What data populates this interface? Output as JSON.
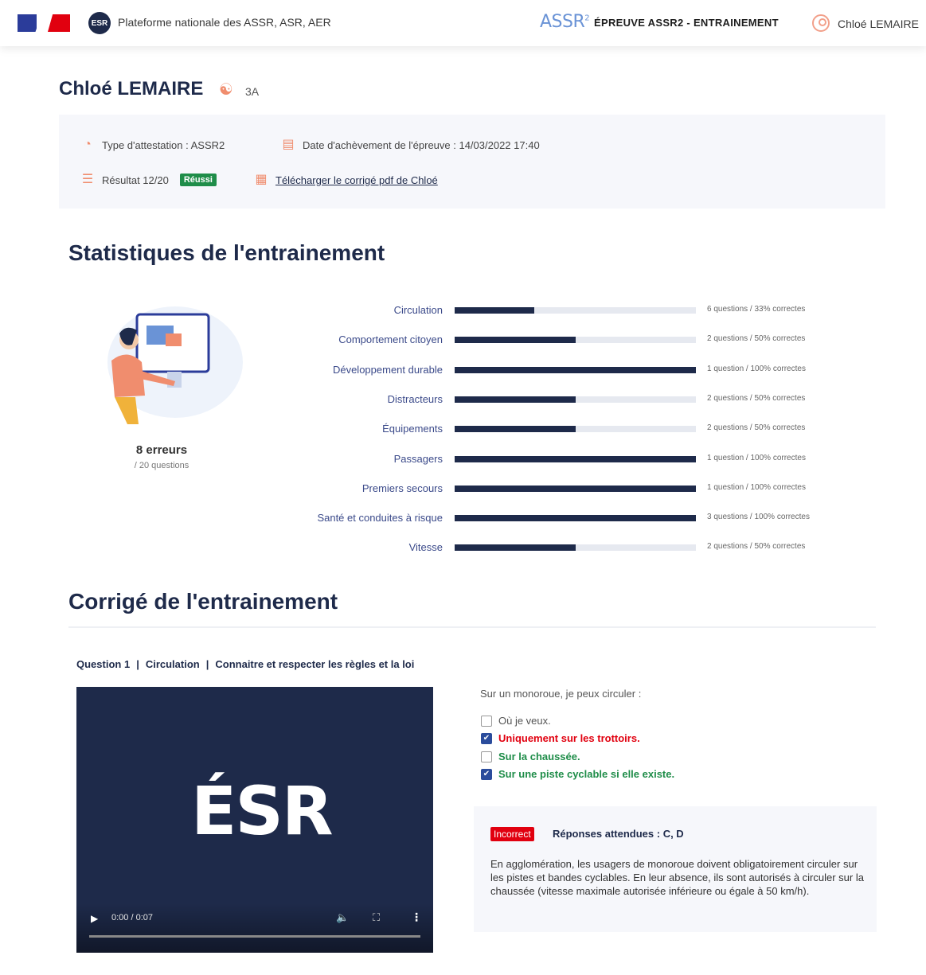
{
  "header": {
    "platform_title": "Plateforme nationale des ASSR, ASR, AER",
    "esr_badge": "ESR",
    "assr_logo": "ASSR",
    "assr_logo_sup": "2",
    "epreuve_title": "ÉPREUVE ASSR2 - ENTRAINEMENT",
    "user_name": "Chloé LEMAIRE"
  },
  "student": {
    "name": "Chloé LEMAIRE",
    "class": "3A"
  },
  "info": {
    "type_attestation": "Type d'attestation : ASSR2",
    "date_achevement": "Date d'achèvement de l'épreuve : 14/03/2022 17:40",
    "resultat": "Résultat 12/20",
    "badge": "Réussi",
    "download_link": "Télécharger le corrigé pdf de Chloé"
  },
  "stats_section": {
    "title": "Statistiques de l'entrainement",
    "errors": "8 erreurs",
    "errors_total": "/ 20 questions"
  },
  "chart_data": {
    "type": "bar",
    "orientation": "horizontal",
    "categories": [
      "Circulation",
      "Comportement citoyen",
      "Développement durable",
      "Distracteurs",
      "Équipements",
      "Passagers",
      "Premiers secours",
      "Santé et conduites à risque",
      "Vitesse"
    ],
    "values": [
      33,
      50,
      100,
      50,
      50,
      100,
      100,
      100,
      50
    ],
    "xlim": [
      0,
      100
    ],
    "labels": [
      "6 questions / 33% correctes",
      "2 questions / 50% correctes",
      "1 question / 100% correctes",
      "2 questions / 50% correctes",
      "2 questions / 50% correctes",
      "1 question / 100% correctes",
      "1 question / 100% correctes",
      "3 questions / 100% correctes",
      "2 questions / 50% correctes"
    ],
    "colors": {
      "fill": "#1e2a4a",
      "track": "#e6e9f0"
    }
  },
  "correction": {
    "title": "Corrigé de l'entrainement",
    "question_number": "Question 1",
    "question_theme": "Circulation",
    "question_topic": "Connaitre et respecter les règles et la loi",
    "question_text": "Sur un monoroue, je peux circuler :",
    "answers": [
      {
        "text": "Où je veux.",
        "checked": false,
        "status": "neutral"
      },
      {
        "text": "Uniquement sur les trottoirs.",
        "checked": true,
        "status": "wrong"
      },
      {
        "text": "Sur la chaussée.",
        "checked": false,
        "status": "right"
      },
      {
        "text": "Sur une piste cyclable si elle existe.",
        "checked": true,
        "status": "right"
      }
    ],
    "result_badge": "Incorrect",
    "expected": "Réponses attendues : C, D",
    "explanation": "En agglomération, les usagers de monoroue doivent obligatoirement circuler sur les pistes et bandes cyclables. En leur absence, ils sont autorisés à circuler sur la chaussée (vitesse maximale autorisée inférieure ou égale à 50 km/h).",
    "video": {
      "logo": "ÉSR",
      "time": "0:00 / 0:07"
    }
  }
}
